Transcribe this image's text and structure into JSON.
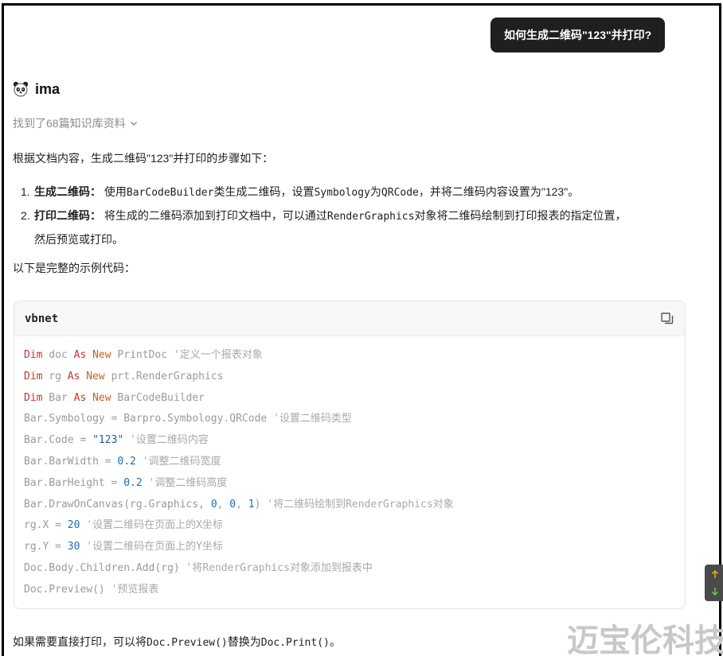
{
  "user_message": "如何生成二维码\"123\"并打印?",
  "assistant": {
    "name": "ima",
    "avatar_icon": "panda-icon"
  },
  "knowledge": {
    "label": "找到了68篇知识库资料",
    "expand_icon": "chevron-down-icon"
  },
  "answer": {
    "intro": "根据文档内容，生成二维码\"123\"并打印的步骤如下：",
    "steps": [
      {
        "number": "1.",
        "title": "生成二维码",
        "sep": "： ",
        "body_parts": [
          "使用",
          "BarCodeBuilder",
          "类生成二维码，设置",
          "Symbology",
          "为",
          "QRCode",
          "，并将二维码内容设置为\"123\"。"
        ]
      },
      {
        "number": "2.",
        "title": "打印二维码",
        "sep": "： ",
        "body_parts": [
          "将生成的二维码添加到打印文档中，可以通过",
          "RenderGraphics",
          "对象将二维码绘制到打印报表的指定位置，",
          "然后预览或打印。"
        ]
      }
    ],
    "code_label": "以下是完整的示例代码：",
    "code": {
      "language": "vbnet",
      "copy_icon": "copy-icon",
      "lines": [
        {
          "tokens": [
            [
              "Dim",
              "kw-red"
            ],
            [
              " doc ",
              ""
            ],
            [
              "As",
              "kw-red"
            ],
            [
              " ",
              ""
            ],
            [
              "New",
              "kw-or"
            ],
            [
              " PrintDoc ",
              ""
            ],
            [
              "'定义一个报表对象",
              "cmt"
            ]
          ]
        },
        {
          "tokens": [
            [
              "Dim",
              "kw-red"
            ],
            [
              " rg ",
              ""
            ],
            [
              "As",
              "kw-red"
            ],
            [
              " ",
              ""
            ],
            [
              "New",
              "kw-or"
            ],
            [
              " prt.RenderGraphics",
              ""
            ]
          ]
        },
        {
          "tokens": [
            [
              "Dim",
              "kw-red"
            ],
            [
              " Bar ",
              ""
            ],
            [
              "As",
              "kw-red"
            ],
            [
              " ",
              ""
            ],
            [
              "New",
              "kw-or"
            ],
            [
              " BarCodeBuilder",
              ""
            ]
          ]
        },
        {
          "tokens": [
            [
              "Bar.Symbology = Barpro.Symbology.QRCode ",
              ""
            ],
            [
              "'设置二维码类型",
              "cmt"
            ]
          ]
        },
        {
          "tokens": [
            [
              "Bar.Code = ",
              ""
            ],
            [
              "\"123\"",
              "str-b"
            ],
            [
              " ",
              ""
            ],
            [
              "'设置二维码内容",
              "cmt"
            ]
          ]
        },
        {
          "tokens": [
            [
              "Bar.BarWidth = ",
              ""
            ],
            [
              "0.2",
              "num-b"
            ],
            [
              " ",
              ""
            ],
            [
              "'调整二维码宽度",
              "cmt"
            ]
          ]
        },
        {
          "tokens": [
            [
              "Bar.BarHeight = ",
              ""
            ],
            [
              "0.2",
              "num-b"
            ],
            [
              " ",
              ""
            ],
            [
              "'调整二维码高度",
              "cmt"
            ]
          ]
        },
        {
          "tokens": [
            [
              "Bar.DrawOnCanvas(rg.Graphics, ",
              ""
            ],
            [
              "0",
              "num-b"
            ],
            [
              ", ",
              ""
            ],
            [
              "0",
              "num-b"
            ],
            [
              ", ",
              ""
            ],
            [
              "1",
              "num-b"
            ],
            [
              ") ",
              ""
            ],
            [
              "'将二维码绘制到RenderGraphics对象",
              "cmt"
            ]
          ]
        },
        {
          "tokens": [
            [
              "rg.X = ",
              ""
            ],
            [
              "20",
              "num-b"
            ],
            [
              " ",
              ""
            ],
            [
              "'设置二维码在页面上的X坐标",
              "cmt"
            ]
          ]
        },
        {
          "tokens": [
            [
              "rg.Y = ",
              ""
            ],
            [
              "30",
              "num-b"
            ],
            [
              " ",
              ""
            ],
            [
              "'设置二维码在页面上的Y坐标",
              "cmt"
            ]
          ]
        },
        {
          "tokens": [
            [
              "Doc.Body.Children.Add(rg) ",
              ""
            ],
            [
              "'将RenderGraphics对象添加到报表中",
              "cmt"
            ]
          ]
        },
        {
          "tokens": [
            [
              "Doc.Preview() ",
              ""
            ],
            [
              "'预览报表",
              "cmt"
            ]
          ]
        }
      ]
    },
    "final_parts": [
      "如果需要直接打印，可以将",
      "Doc.Preview()",
      "替换为",
      "Doc.Print()",
      "。"
    ]
  },
  "scroll_widget": {
    "up_icon": "arrow-up-icon",
    "down_icon": "arrow-down-icon"
  },
  "watermark": "迈宝伦科技",
  "colors": {
    "keyword": "#c4362f",
    "new_keyword": "#c5641c",
    "number": "#1b6fb6",
    "bubble_bg": "#1f1f1f"
  }
}
